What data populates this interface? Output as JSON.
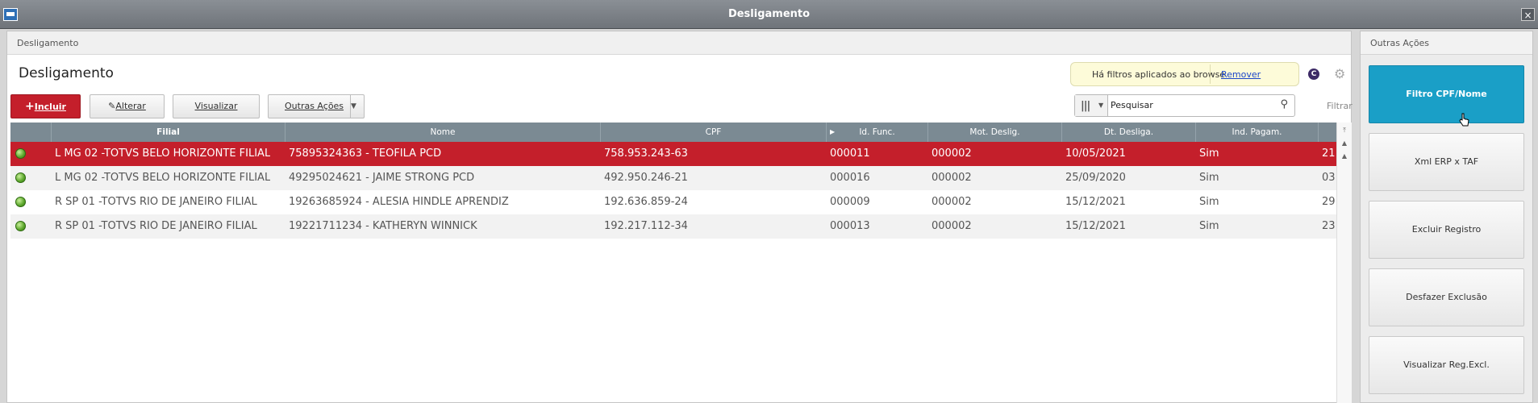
{
  "window": {
    "title": "Desligamento",
    "close_label": "×"
  },
  "main": {
    "panel_header": "Desligamento",
    "page_title": "Desligamento",
    "filter_notice": {
      "message": "Há filtros aplicados ao browse",
      "remove_label": "Remover"
    },
    "c_badge": "C",
    "toolbar": {
      "incluir_prefix": "+",
      "incluir_label": "Incluir",
      "alterar_label": "Alterar",
      "visualizar_label": "Visualizar",
      "outras_acoes_label": "Outras Ações"
    },
    "search": {
      "value": "Pesquisar",
      "placeholder": "Pesquisar"
    },
    "filtrar_label": "Filtrar",
    "grid": {
      "columns": [
        "Filial",
        "Nome",
        "CPF",
        "Id. Func.",
        "Mot. Deslig.",
        "Dt. Desliga.",
        "Ind. Pagam."
      ],
      "rows": [
        {
          "filial": "L MG 02 -TOTVS BELO HORIZONTE FILIAL",
          "nome": "75895324363 - TEOFILA PCD",
          "cpf": "758.953.243-63",
          "id_func": "000011",
          "mot_deslig": "000002",
          "dt_deslig": "10/05/2021",
          "ind_pagam": "Sim",
          "extra": "21",
          "status": "green"
        },
        {
          "filial": "L MG 02 -TOTVS BELO HORIZONTE FILIAL",
          "nome": "49295024621 - JAIME STRONG PCD",
          "cpf": "492.950.246-21",
          "id_func": "000016",
          "mot_deslig": "000002",
          "dt_deslig": "25/09/2020",
          "ind_pagam": "Sim",
          "extra": "03",
          "status": "green"
        },
        {
          "filial": "R SP 01 -TOTVS RIO DE JANEIRO FILIAL",
          "nome": "19263685924 - ALESIA HINDLE APRENDIZ",
          "cpf": "192.636.859-24",
          "id_func": "000009",
          "mot_deslig": "000002",
          "dt_deslig": "15/12/2021",
          "ind_pagam": "Sim",
          "extra": "29",
          "status": "green"
        },
        {
          "filial": "R SP 01 -TOTVS RIO DE JANEIRO FILIAL",
          "nome": "19221711234 - KATHERYN WINNICK",
          "cpf": "192.217.112-34",
          "id_func": "000013",
          "mot_deslig": "000002",
          "dt_deslig": "15/12/2021",
          "ind_pagam": "Sim",
          "extra": "23",
          "status": "green"
        }
      ],
      "selected_row": 0
    }
  },
  "side": {
    "header": "Outras Ações",
    "buttons": [
      "Filtro CPF/Nome",
      "Xml ERP x TAF",
      "Excluir Registro",
      "Desfazer Exclusão",
      "Visualizar Reg.Excl."
    ]
  },
  "colors": {
    "primary_red": "#c41f2b",
    "header_gray": "#7b8a93",
    "accent_blue": "#1a9fc7",
    "status_green": "#5aa52a"
  }
}
